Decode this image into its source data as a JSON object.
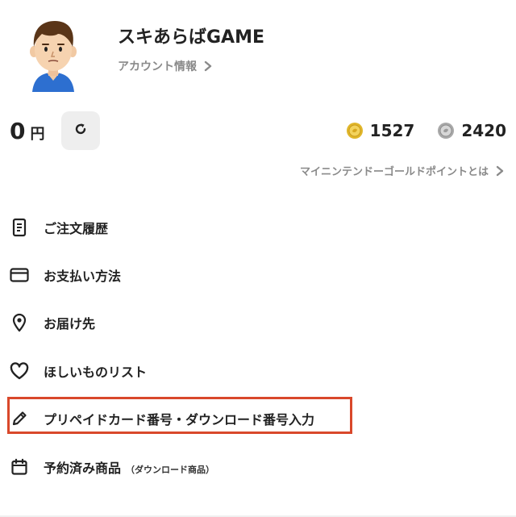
{
  "profile": {
    "username": "スキあらばGAME",
    "account_link": "アカウント情報",
    "avatar_icon": "mii-avatar-icon"
  },
  "balance": {
    "amount": "0",
    "currency": "円",
    "refresh_icon": "refresh-icon"
  },
  "points": {
    "gold": "1527",
    "platinum": "2420",
    "gold_color": "#e0b62a",
    "platinum_color": "#a8a8a8",
    "info_link": "マイニンテンドーゴールドポイントとは"
  },
  "menu": {
    "items": [
      {
        "label": "ご注文履歴",
        "icon": "receipt-icon"
      },
      {
        "label": "お支払い方法",
        "icon": "credit-card-icon"
      },
      {
        "label": "お届け先",
        "icon": "location-pin-icon"
      },
      {
        "label": "ほしいものリスト",
        "icon": "heart-icon"
      },
      {
        "label": "プリペイドカード番号・ダウンロード番号入力",
        "icon": "pencil-icon"
      },
      {
        "label": "予約済み商品",
        "sub": "（ダウンロード商品）",
        "icon": "calendar-icon"
      }
    ]
  },
  "colors": {
    "highlight": "#d9482b",
    "muted_text": "#8a8a8a",
    "refresh_bg": "#eeeeee"
  }
}
